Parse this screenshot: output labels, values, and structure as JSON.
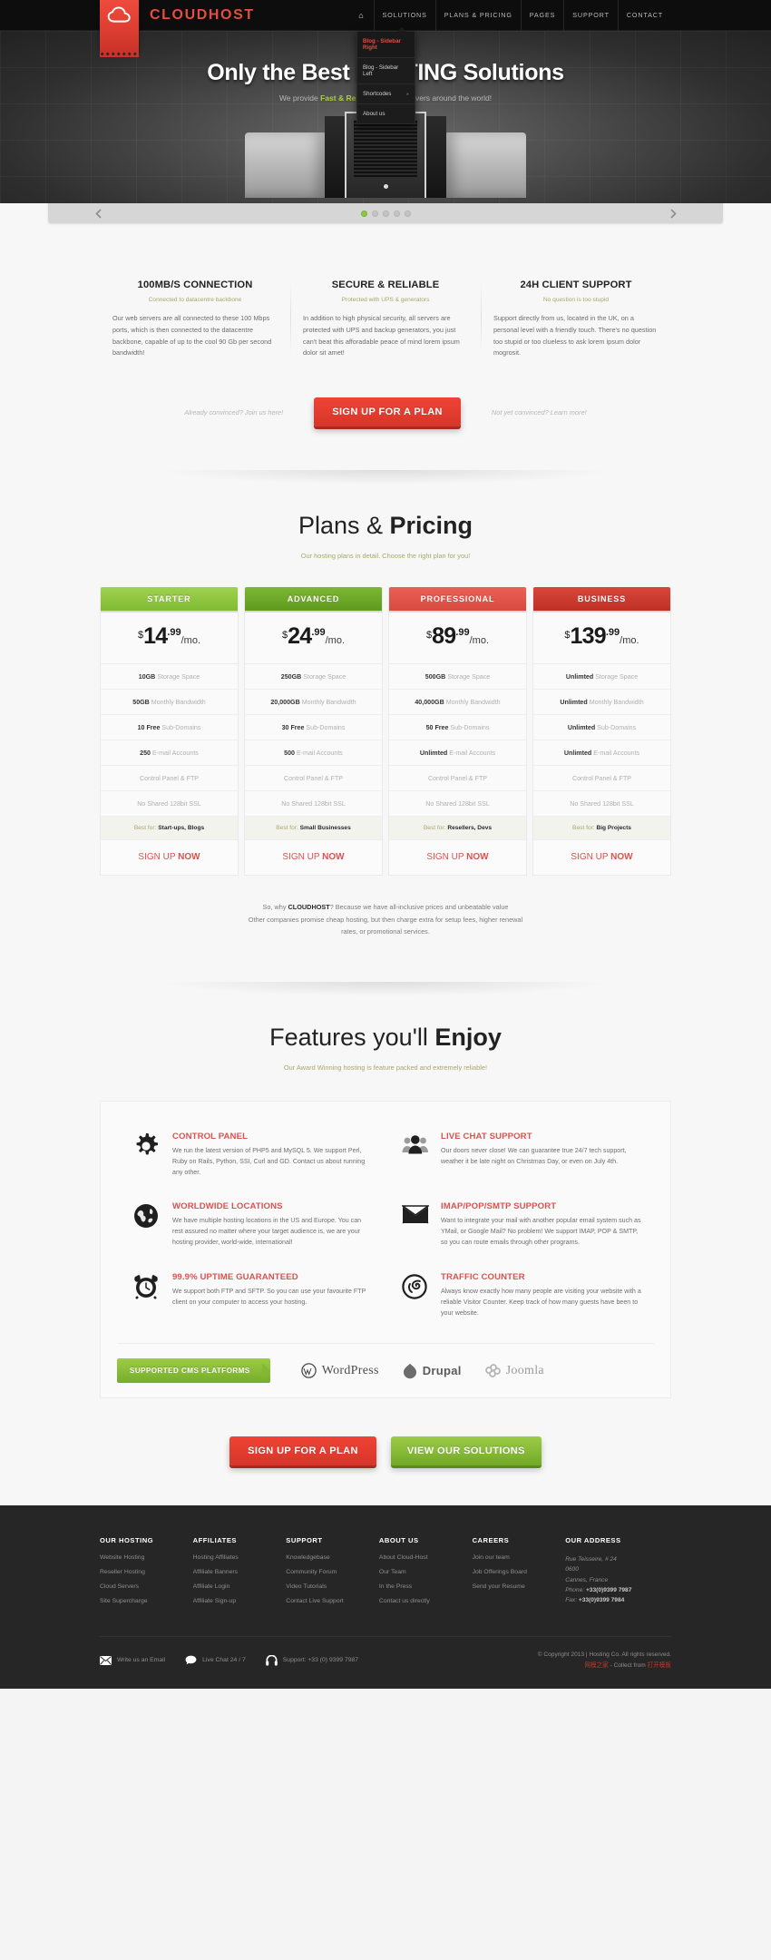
{
  "header": {
    "brand": "CLOUDHOST",
    "logo_icon": "cloud-icon",
    "nav": [
      {
        "label": "⌂",
        "name": "home",
        "active": false
      },
      {
        "label": "SOLUTIONS",
        "name": "solutions",
        "active": false
      },
      {
        "label": "PLANS & PRICING",
        "name": "plans-pricing",
        "active": false
      },
      {
        "label": "PAGES",
        "name": "pages",
        "active": false
      },
      {
        "label": "SUPPORT",
        "name": "support",
        "active": false
      },
      {
        "label": "CONTACT",
        "name": "contact",
        "active": false
      }
    ],
    "dropdown": {
      "open_under": "PAGES",
      "items": [
        {
          "label": "Blog - Sidebar Right",
          "active": true,
          "caret": ""
        },
        {
          "label": "Blog - Sidebar Left",
          "active": false,
          "caret": ""
        },
        {
          "label": "Shortcodes",
          "active": false,
          "caret": "▸"
        },
        {
          "label": "About us",
          "active": false,
          "caret": ""
        }
      ]
    }
  },
  "hero": {
    "title": "Only the Best HOSTING Solutions",
    "subtitle_pre": "We provide ",
    "subtitle_highlight": "Fast & Reliable",
    "subtitle_post": " hosting servers around the world!",
    "prev_icon": "chevron-left-icon",
    "next_icon": "chevron-right-icon",
    "slide_count": 5,
    "active_slide": 1
  },
  "intro": {
    "columns": [
      {
        "title": "100MB/S CONNECTION",
        "tagline": "Connected to datacentre backbone",
        "body": "Our web servers are all connected to these 100 Mbps ports, which is then connected to the datacentre backbone, capable of up to the cool 90 Gb per second bandwidth!"
      },
      {
        "title": "SECURE & RELIABLE",
        "tagline": "Protected with UPS & generators",
        "body": "In addition to high physical security, all servers are protected with UPS and backup generators, you just can't beat this afforadable peace of mind lorem ipsum dolor sit amet!"
      },
      {
        "title": "24H CLIENT SUPPORT",
        "tagline": "No question is too stupid",
        "body": "Support directly from us, located in the UK, on a personal level with a friendly touch. There's no question too stupid or too clueless to ask lorem ipsum dolor mogrosit."
      }
    ],
    "cta_left_note": "Already convinced? Join us here!",
    "cta_button": "SIGN UP FOR A PLAN",
    "cta_right_note": "Not yet convinced? Learn more!"
  },
  "pricing": {
    "title_light": "Plans & ",
    "title_bold": "Pricing",
    "subtitle": "Our hosting plans in detail. Choose the right plan for you!",
    "feature_labels": [
      "Storage Space",
      "Monthly Bandwidth",
      "Sub-Domains",
      "E-mail Accounts",
      "Control Panel & FTP",
      "No Shared 128bit SSL"
    ],
    "signup_label_light": "SIGN UP ",
    "signup_label_bold": "NOW",
    "best_for_label": "Best for:",
    "plans": [
      {
        "name": "STARTER",
        "color": "#8dc63f",
        "currency": "$",
        "price_int": "14",
        "price_dec": ".99",
        "period": "/mo.",
        "features": [
          {
            "value": "10GB",
            "label": "Storage Space"
          },
          {
            "value": "50GB",
            "label": "Monthly Bandwidth"
          },
          {
            "value": "10 Free",
            "label": "Sub-Domains"
          },
          {
            "value": "250",
            "label": "E-mail Accounts"
          },
          {
            "value": "",
            "label": "Control Panel & FTP"
          },
          {
            "value": "",
            "label": "No Shared 128bit SSL"
          }
        ],
        "best_for": "Start-ups, Blogs"
      },
      {
        "name": "ADVANCED",
        "color": "#6fae24",
        "currency": "$",
        "price_int": "24",
        "price_dec": ".99",
        "period": "/mo.",
        "features": [
          {
            "value": "250GB",
            "label": "Storage Space"
          },
          {
            "value": "20,000GB",
            "label": "Monthly Bandwidth"
          },
          {
            "value": "30 Free",
            "label": "Sub-Domains"
          },
          {
            "value": "500",
            "label": "E-mail Accounts"
          },
          {
            "value": "",
            "label": "Control Panel & FTP"
          },
          {
            "value": "",
            "label": "No Shared 128bit SSL"
          }
        ],
        "best_for": "Small Businesses"
      },
      {
        "name": "PROFESSIONAL",
        "color": "#e2574c",
        "currency": "$",
        "price_int": "89",
        "price_dec": ".99",
        "period": "/mo.",
        "features": [
          {
            "value": "500GB",
            "label": "Storage Space"
          },
          {
            "value": "40,000GB",
            "label": "Monthly Bandwidth"
          },
          {
            "value": "50 Free",
            "label": "Sub-Domains"
          },
          {
            "value": "Unlimted",
            "label": "E-mail Accounts"
          },
          {
            "value": "",
            "label": "Control Panel & FTP"
          },
          {
            "value": "",
            "label": "No Shared 128bit SSL"
          }
        ],
        "best_for": "Resellers, Devs"
      },
      {
        "name": "BUSINESS",
        "color": "#cf3a2e",
        "currency": "$",
        "price_int": "139",
        "price_dec": ".99",
        "period": "/mo.",
        "features": [
          {
            "value": "Unlimted",
            "label": "Storage Space"
          },
          {
            "value": "Unlimted",
            "label": "Monthly Bandwidth"
          },
          {
            "value": "Unlimted",
            "label": "Sub-Domains"
          },
          {
            "value": "Unlimted",
            "label": "E-mail Accounts"
          },
          {
            "value": "",
            "label": "Control Panel & FTP"
          },
          {
            "value": "",
            "label": "No Shared 128bit SSL"
          }
        ],
        "best_for": "Big Projects"
      }
    ],
    "why_line1_pre": "So, why ",
    "why_line1_brand": "CLOUDHOST",
    "why_line1_post": "? Because we have all-inclusive prices and unbeatable value",
    "why_line2": "Other companies promise cheap hosting, but then charge extra for setup fees, higher renewal",
    "why_line3": "rates, or promotional services."
  },
  "features": {
    "title_light": "Features you'll ",
    "title_bold": "Enjoy",
    "subtitle": "Our Award Winning hosting is feature packed and extremely reliable!",
    "items": [
      {
        "icon": "gear-icon",
        "title": "CONTROL PANEL",
        "body": "We run the latest version of PHP5 and MySQL 5. We support Perl, Ruby on Rails, Python, SSI, Curl and GD. Contact us about running any other."
      },
      {
        "icon": "users-icon",
        "title": "LIVE CHAT SUPPORT",
        "body": "Our doors never close! We can guarantee true 24/7 tech support, weather it be late night on Christmas Day, or even on July 4th."
      },
      {
        "icon": "globe-icon",
        "title": "WORLDWIDE LOCATIONS",
        "body": "We have multiple hosting locations in the US and Europe. You can rest assured no matter where your target audience is, we are your hosting provider, world-wide, international!"
      },
      {
        "icon": "envelope-icon",
        "title": "IMAP/POP/SMTP SUPPORT",
        "body": "Want to integrate your mail with another popular email system such as YMail, or Google Mail? No problem! We support IMAP, POP & SMTP, so you can route emails through other programs."
      },
      {
        "icon": "alarm-clock-icon",
        "title": "99.9% UPTIME GUARANTEED",
        "title_prefix": "99.9% ",
        "body": "We support both FTP and SFTP. So you can use your favourite FTP client on your computer to access your hosting."
      },
      {
        "icon": "traffic-counter-icon",
        "title": "TRAFFIC COUNTER",
        "body": "Always know exactly how many people are visiting your website with a reliable Visitor Counter. Keep track of how many guests have been to your website."
      }
    ],
    "cms_badge": "SUPPORTED CMS PLATFORMS",
    "cms_logos": [
      {
        "name": "WordPress",
        "icon": "wordpress-icon"
      },
      {
        "name": "Drupal",
        "icon": "drupal-icon",
        "sup": "™"
      },
      {
        "name": "Joomla",
        "icon": "joomla-icon",
        "sup": "!"
      }
    ],
    "bottom_cta_red": "SIGN UP FOR A PLAN",
    "bottom_cta_green": "VIEW OUR SOLUTIONS"
  },
  "footer": {
    "columns": [
      {
        "heading": "OUR HOSTING",
        "links": [
          "Website Hosting",
          "Reseller Hosting",
          "Cloud Servers",
          "Site Supercharge"
        ]
      },
      {
        "heading": "AFFILIATES",
        "links": [
          "Hosting Affiliates",
          "Affiliate Banners",
          "Affiliate Login",
          "Affiliate Sign-up"
        ]
      },
      {
        "heading": "SUPPORT",
        "links": [
          "Knowledgebase",
          "Community Forum",
          "Video Tutorials",
          "Contact Live Support"
        ]
      },
      {
        "heading": "ABOUT US",
        "links": [
          "About Cloud-Host",
          "Our Team",
          "In the Press",
          "Contact us directly"
        ]
      },
      {
        "heading": "CAREERS",
        "links": [
          "Join our team",
          "Job Offerings Board",
          "Send your Resume"
        ]
      }
    ],
    "address": {
      "heading": "OUR ADDRESS",
      "street": "Rue Teisseire, # 24",
      "postcode": "0600",
      "city": "Cannes, France",
      "phone_label": "Phone:",
      "phone": "+33(0)9399 7987",
      "fax_label": "Fax:",
      "fax": "+33(0)9399 7984"
    },
    "contacts": [
      {
        "icon": "mail-icon",
        "label": "Write us an Email"
      },
      {
        "icon": "chat-bubble-icon",
        "label": "Live Chat 24 / 7"
      },
      {
        "icon": "headset-icon",
        "label": "Support: +33 (0) 9399 7987"
      }
    ],
    "copyright": "© Copyright 2013 | Hosting Co. All rights reserved.",
    "credit_cn_left": "网模之家",
    "credit_mid": " - Collect from ",
    "credit_cn_right": "打开模板"
  }
}
